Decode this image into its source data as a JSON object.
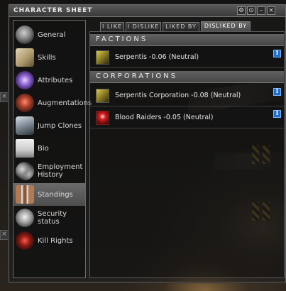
{
  "window": {
    "title": "CHARACTER SHEET",
    "buttons": [
      "⚙",
      "⊙",
      "–",
      "×"
    ]
  },
  "nav": {
    "items": [
      {
        "label": "General"
      },
      {
        "label": "Skills"
      },
      {
        "label": "Attributes"
      },
      {
        "label": "Augmentations"
      },
      {
        "label": "Jump Clones"
      },
      {
        "label": "Bio"
      },
      {
        "label": "Employment\nHistory"
      },
      {
        "label": "Standings",
        "selected": true
      },
      {
        "label": "Security status"
      },
      {
        "label": "Kill Rights"
      }
    ]
  },
  "tabs": [
    {
      "label": "I LIKE"
    },
    {
      "label": "I DISLIKE"
    },
    {
      "label": "LIKED BY"
    },
    {
      "label": "DISLIKED BY",
      "active": true
    }
  ],
  "sections": {
    "factions": {
      "header": "FACTIONS",
      "rows": [
        {
          "text": "Serpentis  -0.06 (Neutral)",
          "info": "i"
        }
      ]
    },
    "corporations": {
      "header": "CORPORATIONS",
      "rows": [
        {
          "text": "Serpentis Corporation  -0.08 (Neutral)",
          "info": "i"
        },
        {
          "text": "Blood Raiders  -0.05 (Neutral)",
          "info": "i"
        }
      ]
    }
  },
  "colors": {
    "accent_info": "#1b6fd4",
    "selected_nav": "#5a5a5a",
    "blood_raiders": "#b01010"
  },
  "icons": {
    "nav": [
      "general-icon",
      "skills-icon",
      "attributes-icon",
      "augmentations-icon",
      "jump-clones-icon",
      "bio-icon",
      "employment-history-icon",
      "standings-icon",
      "security-status-icon",
      "kill-rights-icon"
    ]
  }
}
